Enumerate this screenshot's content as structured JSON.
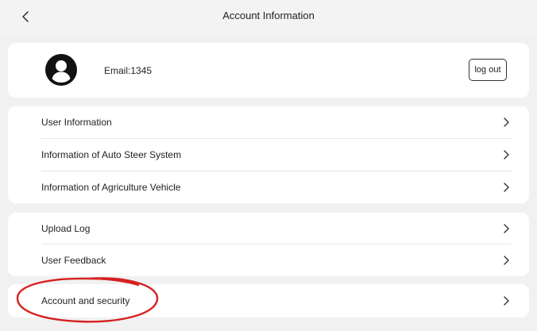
{
  "header": {
    "title": "Account Information",
    "back_icon": "chevron-left-icon"
  },
  "account": {
    "avatar_icon": "user-avatar-icon",
    "email": "Email:1345",
    "logout_label": "log out"
  },
  "groups": [
    {
      "items": [
        {
          "label": "User Information",
          "icon": "chevron-right-icon"
        },
        {
          "label": "Information of Auto Steer System",
          "icon": "chevron-right-icon"
        },
        {
          "label": "Information of Agriculture Vehicle",
          "icon": "chevron-right-icon"
        }
      ]
    },
    {
      "items": [
        {
          "label": "Upload Log",
          "icon": "chevron-right-icon"
        },
        {
          "label": "User Feedback",
          "icon": "chevron-right-icon"
        }
      ]
    },
    {
      "items": [
        {
          "label": "Account and security",
          "icon": "chevron-right-icon"
        }
      ]
    }
  ],
  "colors": {
    "background": "#f1f1f1",
    "card": "#ffffff",
    "divider": "#e6e6e6",
    "highlight_circle": "#d62020"
  }
}
